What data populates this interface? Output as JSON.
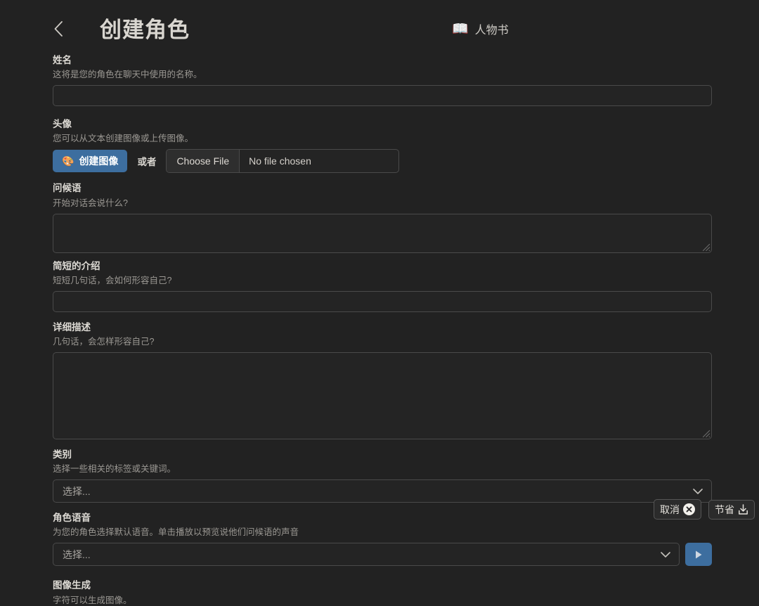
{
  "header": {
    "back_icon": "chevron-left-icon",
    "title": "创建角色",
    "right_icon": "📖",
    "right_label": "人物书"
  },
  "fields": {
    "name": {
      "label": "姓名",
      "hint": "这将是您的角色在聊天中使用的名称。",
      "value": "",
      "placeholder": ""
    },
    "avatar": {
      "label": "头像",
      "hint": "您可以从文本创建图像或上传图像。",
      "create_button": "创建图像",
      "create_button_icon": "🎨",
      "or_text": "或者",
      "file_button": "Choose File",
      "file_status": "No file chosen"
    },
    "greeting": {
      "label": "问候语",
      "hint": "开始对话会说什么?",
      "value": "",
      "placeholder": ""
    },
    "short_intro": {
      "label": "简短的介绍",
      "hint": "短短几句话，会如何形容自己?",
      "value": "",
      "placeholder": ""
    },
    "detail_description": {
      "label": "详细描述",
      "hint": "几句话，会怎样形容自己?",
      "value": "",
      "placeholder": ""
    },
    "category": {
      "label": "类别",
      "hint": "选择一些相关的标签或关键词。",
      "selected": "选择...",
      "chevron_icon": "chevron-down-icon"
    },
    "voice": {
      "label": "角色语音",
      "hint": "为您的角色选择默认语音。单击播放以预览说他们问候语的声音",
      "selected": "选择...",
      "chevron_icon": "chevron-down-icon",
      "play_icon": "play-icon"
    },
    "image_generation": {
      "label": "图像生成",
      "hint": "字符可以生成图像。"
    }
  },
  "floating_actions": {
    "cancel_label": "取消",
    "cancel_icon": "close-circle-icon",
    "save_label": "节省",
    "save_icon": "download-icon"
  },
  "colors": {
    "background": "#222222",
    "accent_blue": "#3d6e9f",
    "input_background": "#242424",
    "border": "#4a4a4a",
    "text_primary": "#d9d6d0",
    "text_secondary": "#9b9893"
  }
}
